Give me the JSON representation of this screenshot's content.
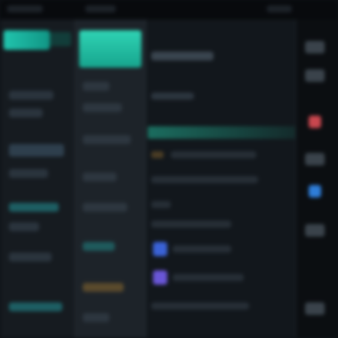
{
  "colors": {
    "accent_teal": "#21c4ad",
    "accent_teal_dark": "#17a58e",
    "accent_blue": "#3a62d6",
    "accent_purple": "#6a56d8",
    "status_red": "#c9464e",
    "status_blue": "#2e7dd8",
    "background": "#0e1216"
  },
  "icons": {
    "brand": "app-logo-icon",
    "row_blue": "square-icon",
    "row_purple": "square-icon",
    "right_controls": [
      "toggle-icon",
      "close-icon",
      "settings-icon",
      "info-icon"
    ]
  },
  "text": {}
}
